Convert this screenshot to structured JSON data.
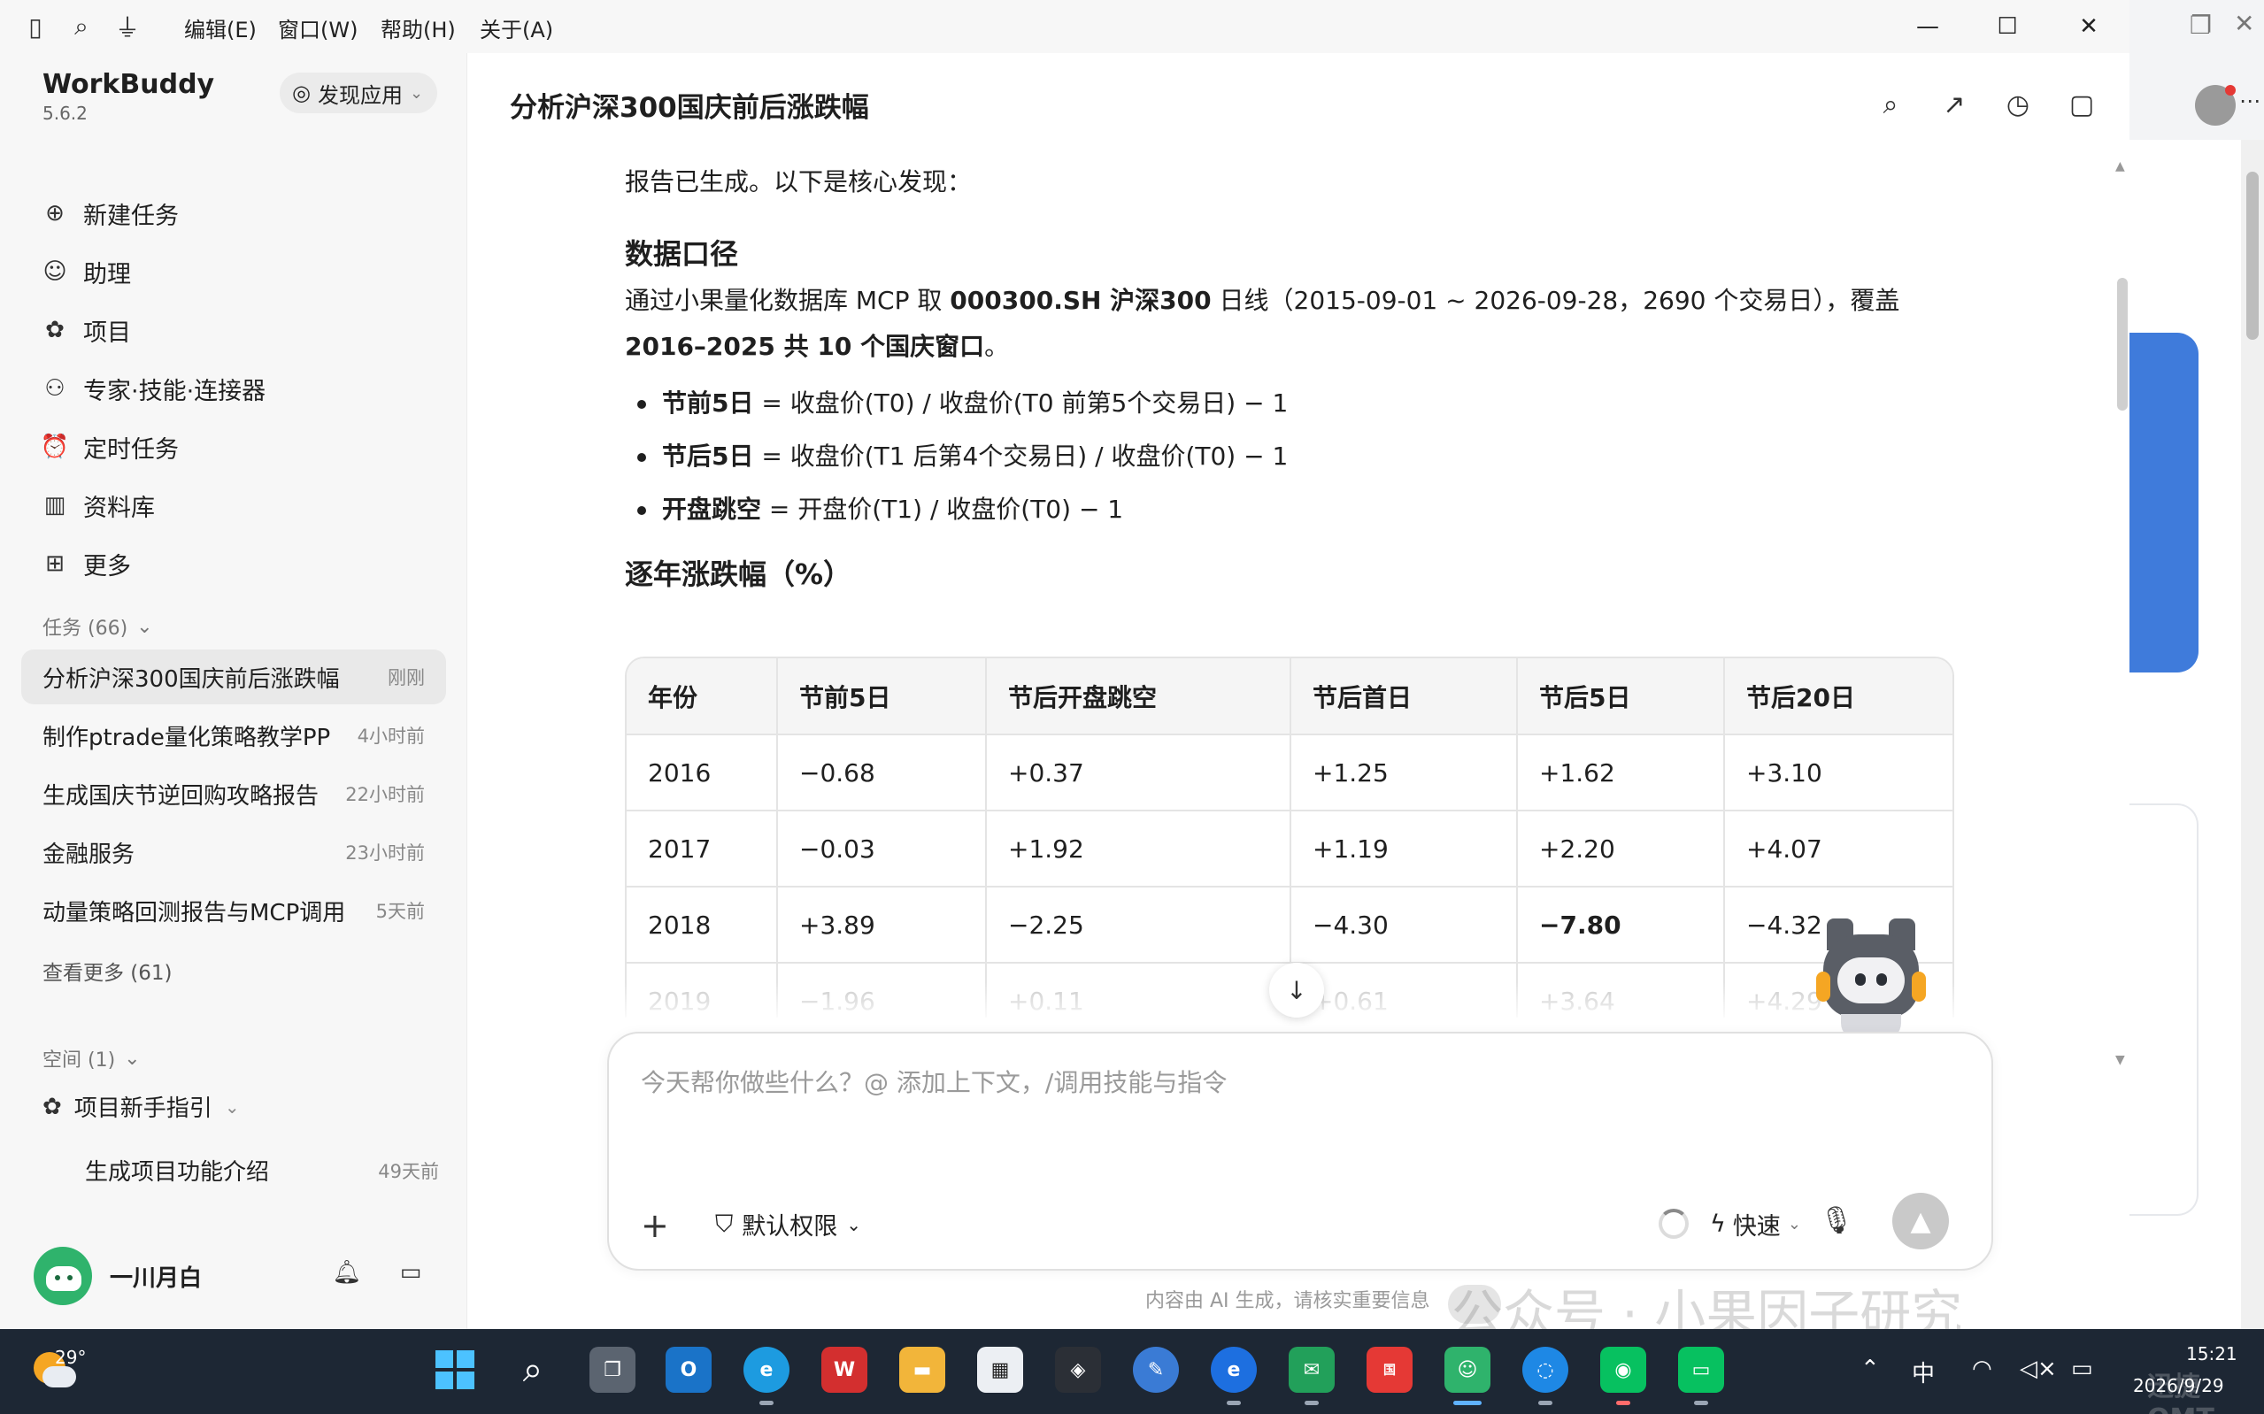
{
  "titlebar": {
    "menus": [
      "编辑(E)",
      "窗口(W)",
      "帮助(H)",
      "关于(A)"
    ],
    "icons": [
      "sidebar-toggle-icon",
      "search-icon",
      "filter-icon"
    ]
  },
  "sidebar": {
    "app_name": "WorkBuddy",
    "version": "5.6.2",
    "discover_label": "发现应用",
    "nav": [
      {
        "label": "新建任务",
        "icon": "plus-circle-icon"
      },
      {
        "label": "助理",
        "icon": "robot-icon"
      },
      {
        "label": "项目",
        "icon": "project-icon"
      },
      {
        "label": "专家·技能·连接器",
        "icon": "expert-icon"
      },
      {
        "label": "定时任务",
        "icon": "alarm-icon"
      },
      {
        "label": "资料库",
        "icon": "book-icon"
      },
      {
        "label": "更多",
        "icon": "more-grid-icon"
      }
    ],
    "tasks_header": "任务 (66)",
    "tasks": [
      {
        "title": "分析沪深300国庆前后涨跌幅",
        "time": "刚刚"
      },
      {
        "title": "制作ptrade量化策略教学PP",
        "time": "4小时前"
      },
      {
        "title": "生成国庆节逆回购攻略报告",
        "time": "22小时前"
      },
      {
        "title": "金融服务",
        "time": "23小时前"
      },
      {
        "title": "动量策略回测报告与MCP调用",
        "time": "5天前"
      }
    ],
    "see_more": "查看更多 (61)",
    "spaces_header": "空间 (1)",
    "space_name": "项目新手指引",
    "space_sub": {
      "title": "生成项目功能介绍",
      "time": "49天前"
    },
    "user_name": "一川月白"
  },
  "main": {
    "title": "分析沪深300国庆前后涨跌幅",
    "intro": "报告已生成。以下是核心发现：",
    "h_data": "数据口径",
    "data_p1": "通过小果量化数据库 MCP 取 ",
    "data_p1_b1": "000300.SH 沪深300",
    "data_p1_rest": " 日线（2015-09-01 ~ 2026-09-28，2690 个交易日），覆盖 ",
    "data_p1_b2": "2016–2025 共 10 个国庆窗口",
    "data_p1_end": "。",
    "bullets": [
      {
        "term": "节前5日",
        "def": " = 收盘价(T0) / 收盘价(T0 前第5个交易日) − 1"
      },
      {
        "term": "节后5日",
        "def": " = 收盘价(T1 后第4个交易日) / 收盘价(T0) − 1"
      },
      {
        "term": "开盘跳空",
        "def": " = 开盘价(T1) / 收盘价(T0) − 1"
      }
    ],
    "h_table": "逐年涨跌幅（%）",
    "table": {
      "headers": [
        "年份",
        "节前5日",
        "节后开盘跳空",
        "节后首日",
        "节后5日",
        "节后20日"
      ],
      "rows": [
        [
          "2016",
          "−0.68",
          "+0.37",
          "+1.25",
          "+1.62",
          "+3.10"
        ],
        [
          "2017",
          "−0.03",
          "+1.92",
          "+1.19",
          "+2.20",
          "+4.07"
        ],
        [
          "2018",
          "+3.89",
          "−2.25",
          "−4.30",
          "−7.80",
          "−4.32"
        ],
        [
          "2019",
          "−1.96",
          "+0.11",
          "+0.61",
          "+3.64",
          "+4.29"
        ]
      ]
    },
    "input_placeholder": "今天帮你做些什么？@ 添加上下文，/调用技能与指令",
    "permission_label": "默认权限",
    "speed_label": "快速",
    "ai_note": "内容由 AI 生成，请核实重要信息",
    "watermark": "公众号 · 小果因子研究"
  },
  "taskbar": {
    "temp": "29°",
    "time": "15:21",
    "date": "2026/9/29",
    "ime": "中",
    "watermark_logo": "迅捷OMT"
  },
  "colors": {
    "accent_blue": "#3f7bdb",
    "taskbar_bg": "#1d2734",
    "avatar_green": "#2fb36c"
  }
}
